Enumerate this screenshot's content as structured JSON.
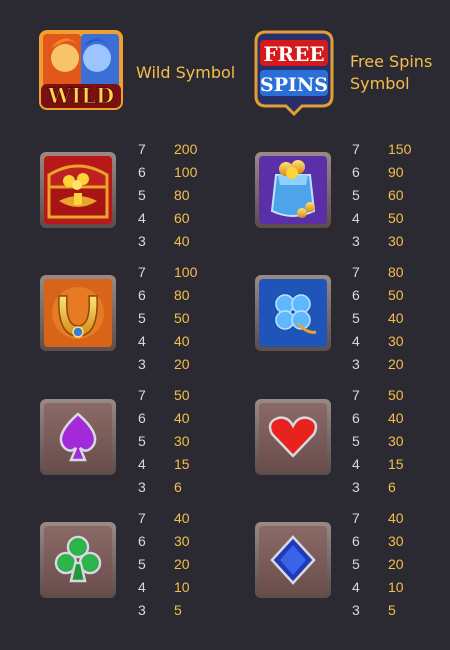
{
  "top": {
    "wild": {
      "icon_text": "WILD",
      "label": "Wild Symbol"
    },
    "free": {
      "icon_text_1": "FREE",
      "icon_text_2": "SPINS",
      "label_1": "Free Spins",
      "label_2": "Symbol"
    }
  },
  "paytable": [
    {
      "icon": "treasure-chest-icon",
      "rows": [
        {
          "n": "7",
          "v": "200"
        },
        {
          "n": "6",
          "v": "100"
        },
        {
          "n": "5",
          "v": "80"
        },
        {
          "n": "4",
          "v": "60"
        },
        {
          "n": "3",
          "v": "40"
        }
      ]
    },
    {
      "icon": "gold-sack-icon",
      "rows": [
        {
          "n": "7",
          "v": "150"
        },
        {
          "n": "6",
          "v": "90"
        },
        {
          "n": "5",
          "v": "60"
        },
        {
          "n": "4",
          "v": "50"
        },
        {
          "n": "3",
          "v": "30"
        }
      ]
    },
    {
      "icon": "horseshoe-icon",
      "rows": [
        {
          "n": "7",
          "v": "100"
        },
        {
          "n": "6",
          "v": "80"
        },
        {
          "n": "5",
          "v": "50"
        },
        {
          "n": "4",
          "v": "40"
        },
        {
          "n": "3",
          "v": "20"
        }
      ]
    },
    {
      "icon": "clover-icon",
      "rows": [
        {
          "n": "7",
          "v": "80"
        },
        {
          "n": "6",
          "v": "50"
        },
        {
          "n": "5",
          "v": "40"
        },
        {
          "n": "4",
          "v": "30"
        },
        {
          "n": "3",
          "v": "20"
        }
      ]
    },
    {
      "icon": "spade-icon",
      "rows": [
        {
          "n": "7",
          "v": "50"
        },
        {
          "n": "6",
          "v": "40"
        },
        {
          "n": "5",
          "v": "30"
        },
        {
          "n": "4",
          "v": "15"
        },
        {
          "n": "3",
          "v": "6"
        }
      ]
    },
    {
      "icon": "heart-icon",
      "rows": [
        {
          "n": "7",
          "v": "50"
        },
        {
          "n": "6",
          "v": "40"
        },
        {
          "n": "5",
          "v": "30"
        },
        {
          "n": "4",
          "v": "15"
        },
        {
          "n": "3",
          "v": "6"
        }
      ]
    },
    {
      "icon": "club-icon",
      "rows": [
        {
          "n": "7",
          "v": "40"
        },
        {
          "n": "6",
          "v": "30"
        },
        {
          "n": "5",
          "v": "20"
        },
        {
          "n": "4",
          "v": "10"
        },
        {
          "n": "3",
          "v": "5"
        }
      ]
    },
    {
      "icon": "diamond-icon",
      "rows": [
        {
          "n": "7",
          "v": "40"
        },
        {
          "n": "6",
          "v": "30"
        },
        {
          "n": "5",
          "v": "20"
        },
        {
          "n": "4",
          "v": "10"
        },
        {
          "n": "3",
          "v": "5"
        }
      ]
    }
  ],
  "colors": {
    "background": "#2b2a33",
    "payout": "#f3bf4a",
    "count": "#d8d8dc"
  }
}
